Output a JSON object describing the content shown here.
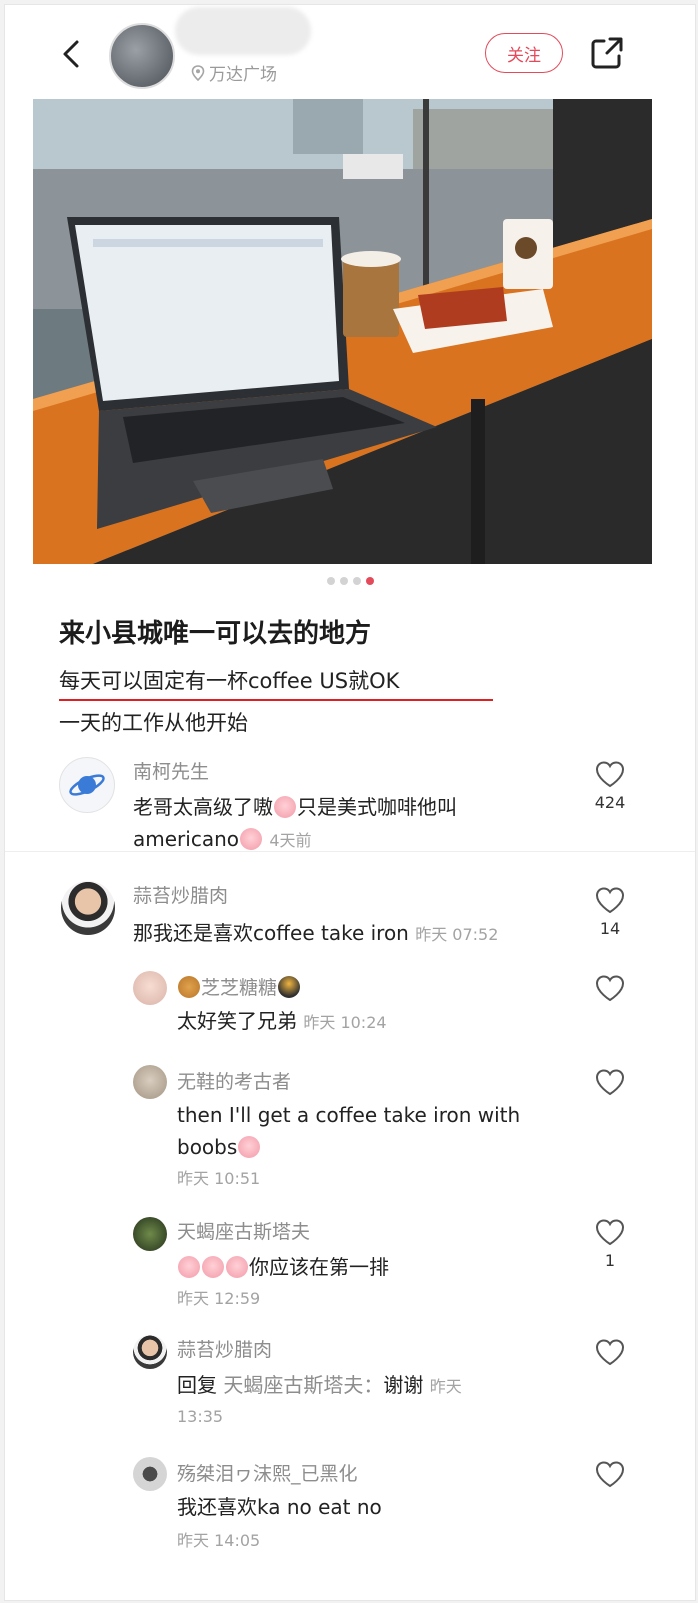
{
  "header": {
    "location": "万达广场",
    "follow_label": "关注"
  },
  "carousel": {
    "total": 4,
    "active": 4
  },
  "post": {
    "title": "来小县城唯一可以去的地方",
    "line1": "每天可以固定有一杯coffee US就OK",
    "line2": "一天的工作从他开始"
  },
  "comments": [
    {
      "name": "南柯先生",
      "text1": "老哥太高级了嗷",
      "text2": "只是美式咖啡他叫",
      "text3": "americano",
      "time": "4天前",
      "likes": "424"
    },
    {
      "name": "蒜苔炒腊肉",
      "text": "那我还是喜欢coffee take iron",
      "time": "昨天 07:52",
      "likes": "14"
    },
    {
      "name": "芝芝糖糖",
      "text": "太好笑了兄弟",
      "time": "昨天 10:24"
    },
    {
      "name": "无鞋的考古者",
      "text1": "then I'll get a coffee take iron with",
      "text2": "boobs",
      "time": "昨天 10:51"
    },
    {
      "name": "天蝎座古斯塔夫",
      "text": "你应该在第一排",
      "time": "昨天 12:59",
      "likes": "1"
    },
    {
      "name": "蒜苔炒腊肉",
      "reply_prefix": "回复",
      "reply_to": "天蝎座古斯塔夫：",
      "text": "谢谢",
      "time_a": "昨天",
      "time_b": "13:35"
    },
    {
      "name": "殇桀泪ヮ沫熙_已黑化",
      "text": "我还喜欢ka no eat no",
      "time": "昨天 14:05"
    }
  ]
}
